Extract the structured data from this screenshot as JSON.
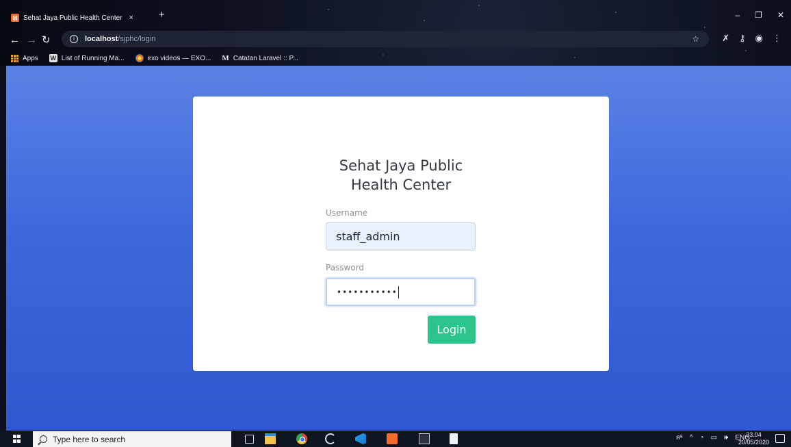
{
  "browser": {
    "tab_title": "Sehat Jaya Public Health Center",
    "tab_close": "×",
    "new_tab": "+",
    "url_host": "localhost",
    "url_path": "/sjphc/login",
    "bookmarks": [
      {
        "label": "Apps",
        "icon": "apps-grid-icon"
      },
      {
        "label": "List of Running Ma...",
        "icon": "w-favicon-icon"
      },
      {
        "label": "exo videos — EXO...",
        "icon": "flower-favicon-icon"
      },
      {
        "label": "Catatan Laravel :: P...",
        "icon": "m-favicon-icon"
      }
    ]
  },
  "login": {
    "title_line1": "Sehat Jaya Public",
    "title_line2": "Health Center",
    "username_label": "Username",
    "username_value": "staff_admin",
    "password_label": "Password",
    "password_masked": "•••••••••••",
    "submit_label": "Login"
  },
  "taskbar": {
    "search_placeholder": "Type here to search",
    "language": "ENG",
    "time": "23.04",
    "date": "20/05/2020"
  },
  "colors": {
    "page_gradient_top": "#5a82e4",
    "page_gradient_bottom": "#2f57cf",
    "login_button": "#2bc58b",
    "username_autofill_bg": "#e8f0fe"
  }
}
